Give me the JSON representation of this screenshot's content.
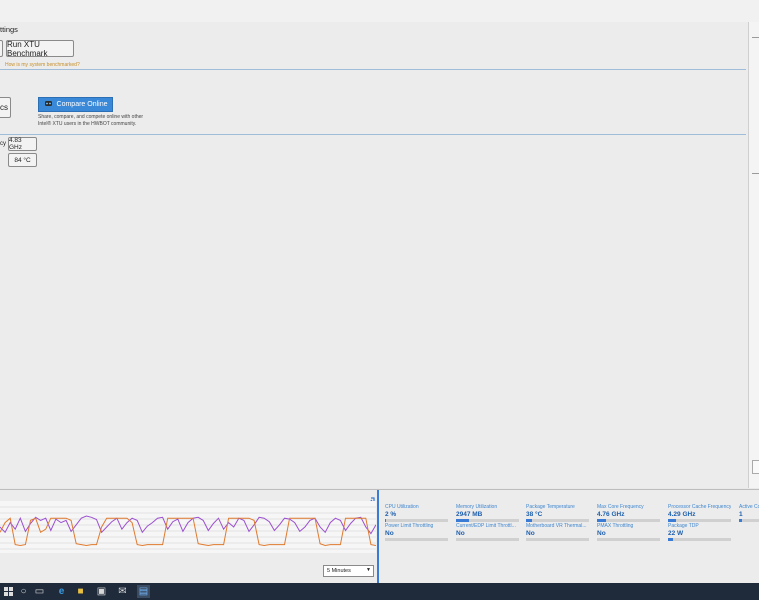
{
  "header": {
    "settings_label": "ttings"
  },
  "benchmark": {
    "run_button": "Run XTU Benchmark",
    "help_link": "How is my system benchmarked?"
  },
  "compare": {
    "partial_tab": "cs",
    "button": "Compare Online",
    "description_line1": "Share, compare, and compete online with other",
    "description_line2": "Intel® XTU users in the HWBOT community."
  },
  "readouts": {
    "partial_label": "cy",
    "frequency": "4.83 GHz",
    "temperature": "84 °C"
  },
  "graph": {
    "time_range": "5 Minutes",
    "series": [
      {
        "color": "#9b4fd0",
        "values": [
          0.5,
          0.62,
          0.4,
          0.55,
          0.3,
          0.6,
          0.42,
          0.28,
          0.35,
          0.3,
          0.58,
          0.32,
          0.4,
          0.35,
          0.6,
          0.45,
          0.3,
          0.25,
          0.28,
          0.33,
          0.62,
          0.5,
          0.38,
          0.3,
          0.55,
          0.4,
          0.3,
          0.35,
          0.62,
          0.48,
          0.4,
          0.3,
          0.28,
          0.55,
          0.38,
          0.32,
          0.6,
          0.4,
          0.3,
          0.28,
          0.35,
          0.58,
          0.42,
          0.3,
          0.55,
          0.4,
          0.5,
          0.3,
          0.35,
          0.6,
          0.45,
          0.28,
          0.3,
          0.38,
          0.58,
          0.45,
          0.3,
          0.32,
          0.4,
          0.6,
          0.5,
          0.35,
          0.3,
          0.5,
          0.62,
          0.4,
          0.3,
          0.35,
          0.58,
          0.42,
          0.3,
          0.28,
          0.5,
          0.65,
          0.45
        ]
      },
      {
        "color": "#e07a2e",
        "values": [
          0.62,
          0.4,
          0.3,
          0.9,
          0.92,
          0.9,
          0.35,
          0.3,
          0.62,
          0.55,
          0.3,
          0.3,
          0.3,
          0.3,
          0.35,
          0.88,
          0.9,
          0.92,
          0.9,
          0.9,
          0.5,
          0.3,
          0.3,
          0.3,
          0.3,
          0.3,
          0.4,
          0.9,
          0.92,
          0.9,
          0.9,
          0.9,
          0.9,
          0.3,
          0.3,
          0.3,
          0.3,
          0.3,
          0.3,
          0.88,
          0.9,
          0.92,
          0.9,
          0.9,
          0.9,
          0.3,
          0.3,
          0.3,
          0.3,
          0.3,
          0.35,
          0.9,
          0.92,
          0.9,
          0.9,
          0.9,
          0.9,
          0.3,
          0.3,
          0.3,
          0.3,
          0.3,
          0.3,
          0.88,
          0.92,
          0.9,
          0.9,
          0.9,
          0.3,
          0.3,
          0.3,
          0.3,
          0.3,
          0.9,
          0.92
        ]
      }
    ]
  },
  "metrics": [
    {
      "label": "CPU Utilization",
      "value": "2 %",
      "level": 0.02
    },
    {
      "label": "Memory Utilization",
      "value": "2947 MB",
      "level": 0.2
    },
    {
      "label": "Package Temperature",
      "value": "38 °C",
      "level": 0.1
    },
    {
      "label": "Max Core Frequency",
      "value": "4.76 GHz",
      "level": 0.15
    },
    {
      "label": "Processor Cache Frequency",
      "value": "4.29 GHz",
      "level": 0.12
    },
    {
      "label": "Active Co",
      "value": "1",
      "level": 0.15
    },
    {
      "label": "Power Limit Throttling",
      "value": "No",
      "level": 0
    },
    {
      "label": "Current/EDP Limit Throttl...",
      "value": "No",
      "level": 0
    },
    {
      "label": "Motherboard VR Thermal...",
      "value": "No",
      "level": 0
    },
    {
      "label": "PMAX Throttling",
      "value": "No",
      "level": 0
    },
    {
      "label": "Package TDP",
      "value": "22 W",
      "level": 0.08
    }
  ],
  "taskbar": {
    "icons": [
      "task-view-icon",
      "edge-icon",
      "file-explorer-icon",
      "store-icon",
      "mail-icon",
      "xtu-app-icon"
    ]
  }
}
